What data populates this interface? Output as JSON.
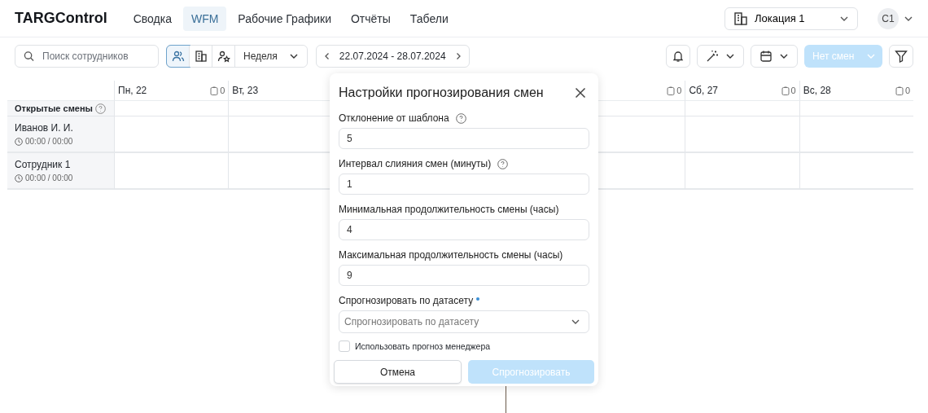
{
  "header": {
    "logo": "TARGControl",
    "nav": [
      {
        "label": "Сводка",
        "selected": false
      },
      {
        "label": "WFM",
        "selected": true
      },
      {
        "label": "Рабочие Графики",
        "selected": false
      },
      {
        "label": "Отчёты",
        "selected": false
      },
      {
        "label": "Табели",
        "selected": false
      }
    ],
    "location": "Локация 1",
    "avatar": "С1"
  },
  "toolbar": {
    "search": {
      "placeholder": "Поиск сотрудников"
    },
    "views": [
      {
        "kind": "people",
        "selected": true
      },
      {
        "kind": "building",
        "selected": false
      },
      {
        "kind": "star",
        "selected": false
      }
    ],
    "period": "Неделя",
    "date_range": "22.07.2024 - 28.07.2024",
    "shifts_button": {
      "label": "Нет смен",
      "disabled": true
    }
  },
  "schedule": {
    "open_shifts": "Открытые смены",
    "days": [
      {
        "label": "Пн, 22",
        "count": "0"
      },
      {
        "label": "Вт, 23"
      },
      {
        "count": "0"
      },
      {
        "label": "Сб, 27",
        "count": "0"
      },
      {
        "label": "Вс, 28",
        "count": "0"
      }
    ],
    "employees": [
      {
        "name": "Иванов И. И.",
        "hours": "00:00 / 00:00"
      },
      {
        "name": "Сотрудник 1",
        "hours": "00:00 / 00:00"
      }
    ]
  },
  "dialog": {
    "title": "Настройки прогнозирования смен",
    "fields": [
      {
        "kind": "input",
        "label": "Отклонение от шаблона",
        "help": true,
        "value": "5"
      },
      {
        "kind": "input",
        "label": "Интервал слияния смен (минуты)",
        "help": true,
        "value": "1"
      },
      {
        "kind": "input",
        "label": "Минимальная продолжительность смены (часы)",
        "help": false,
        "value": "4"
      },
      {
        "kind": "input",
        "label": "Максимальная продолжительность смены (часы)",
        "help": false,
        "value": "9"
      },
      {
        "kind": "select",
        "label": "Спрогнозировать по датасету",
        "required": true,
        "placeholder": "Спрогнозировать по датасету"
      }
    ],
    "checkbox": {
      "label": "Использовать прогноз менеджера",
      "checked": false
    },
    "buttons": [
      {
        "kind": "secondary",
        "label": "Отмена",
        "disabled": false
      },
      {
        "kind": "primary",
        "label": "Спрогнозировать",
        "disabled": true
      }
    ]
  }
}
